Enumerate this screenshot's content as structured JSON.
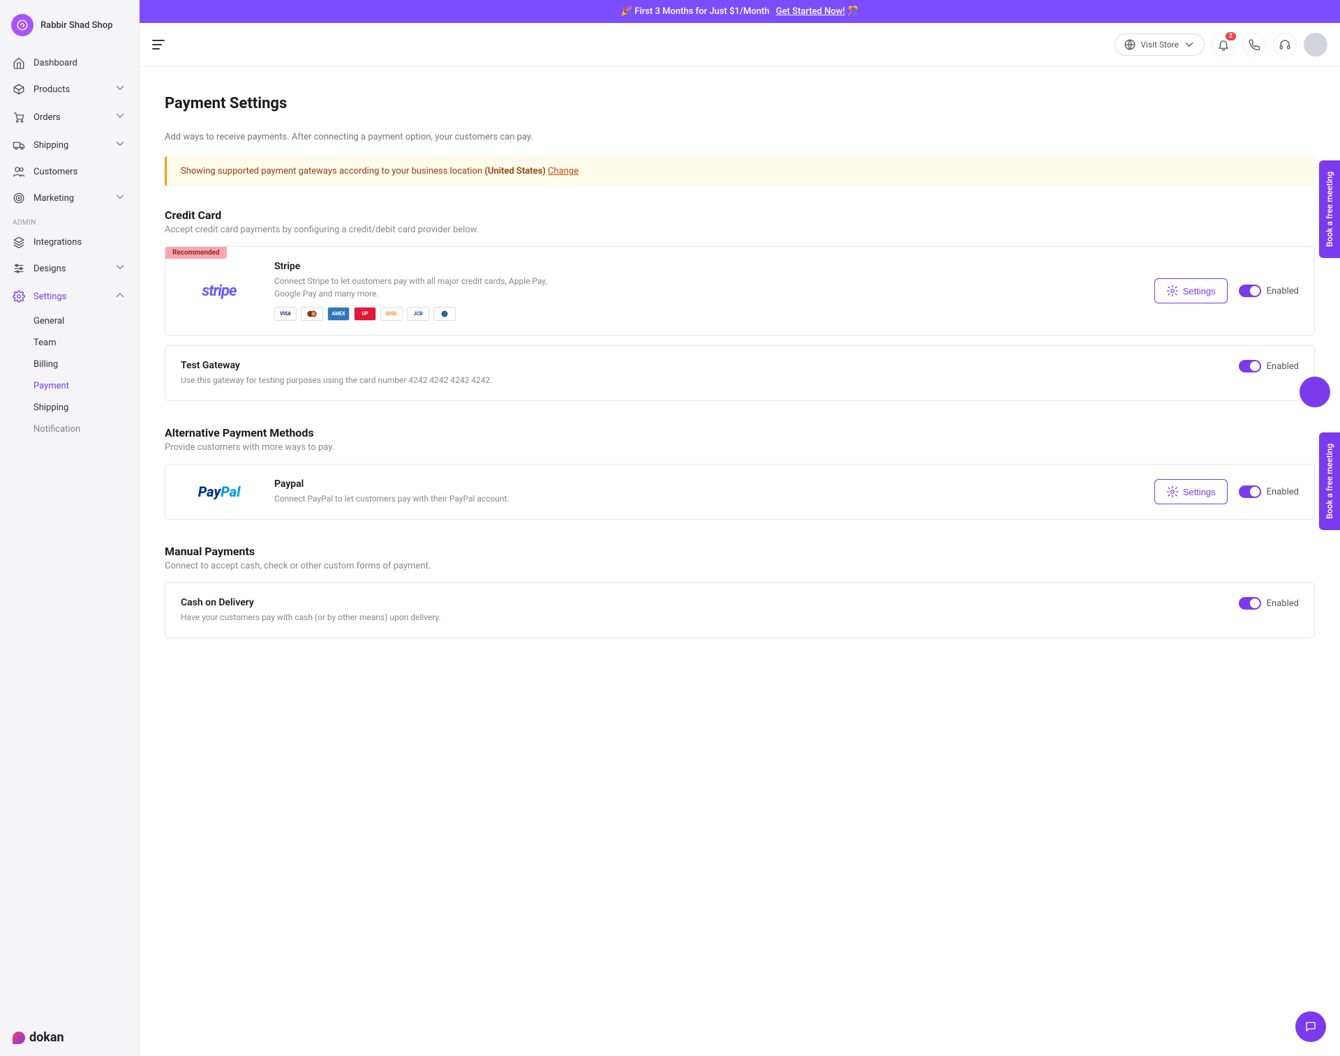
{
  "shop": {
    "name": "Rabbir Shad Shop"
  },
  "promo": {
    "text": "🎉 First 3 Months for Just $1/Month",
    "cta": "Get Started Now!",
    "emoji": "🎊"
  },
  "topbar": {
    "visitStore": "Visit Store",
    "notificationCount": "2"
  },
  "sidebar": {
    "items": [
      {
        "label": "Dashboard",
        "icon": "home"
      },
      {
        "label": "Products",
        "icon": "box",
        "expand": true
      },
      {
        "label": "Orders",
        "icon": "cart",
        "expand": true
      },
      {
        "label": "Shipping",
        "icon": "truck",
        "expand": true
      },
      {
        "label": "Customers",
        "icon": "users"
      },
      {
        "label": "Marketing",
        "icon": "target",
        "expand": true
      }
    ],
    "adminLabel": "ADMIN",
    "adminItems": [
      {
        "label": "Integrations",
        "icon": "layers"
      },
      {
        "label": "Designs",
        "icon": "sliders",
        "expand": true
      },
      {
        "label": "Settings",
        "icon": "gear",
        "expand": true,
        "active": true
      }
    ],
    "settingsSub": [
      {
        "label": "General"
      },
      {
        "label": "Team"
      },
      {
        "label": "Billing"
      },
      {
        "label": "Payment",
        "active": true
      },
      {
        "label": "Shipping"
      },
      {
        "label": "Notification"
      }
    ],
    "brand": "dokan"
  },
  "page": {
    "title": "Payment Settings",
    "subtitle": "Add ways to receive payments. After connecting a payment option, your customers can pay.",
    "alertPrefix": "Showing supported payment gateways according to your business location ",
    "alertLocation": "(United States)",
    "alertChange": "Change"
  },
  "sections": {
    "credit": {
      "title": "Credit Card",
      "sub": "Accept credit card payments by configuring a credit/debit card provider below."
    },
    "alt": {
      "title": "Alternative Payment Methods",
      "sub": "Provide customers with more ways to pay."
    },
    "manual": {
      "title": "Manual Payments",
      "sub": "Connect to accept cash, check or other custom forms of payment."
    }
  },
  "gateways": {
    "stripe": {
      "name": "Stripe",
      "desc": "Connect Stripe to let customers pay with all major credit cards, Apple Pay, Google Pay and many more.",
      "recommended": "Recommended",
      "settings": "Settings",
      "status": "Enabled",
      "logo": "stripe",
      "cardBrands": [
        "VISA",
        "MC",
        "AMEX",
        "UP",
        "DISC",
        "JCB",
        "DC"
      ]
    },
    "test": {
      "name": "Test Gateway",
      "desc": "Use this gateway for testing purposes using the card number 4242 4242 4242 4242.",
      "status": "Enabled"
    },
    "paypal": {
      "name": "Paypal",
      "desc": "Connect PayPal to let customers pay with their PayPal account.",
      "settings": "Settings",
      "status": "Enabled",
      "logo": "PayPal"
    },
    "cod": {
      "name": "Cash on Delivery",
      "desc": "Have your customers pay with cash (or by other means) upon delivery.",
      "status": "Enabled"
    }
  },
  "floats": {
    "meeting": "Book a free meeting"
  }
}
